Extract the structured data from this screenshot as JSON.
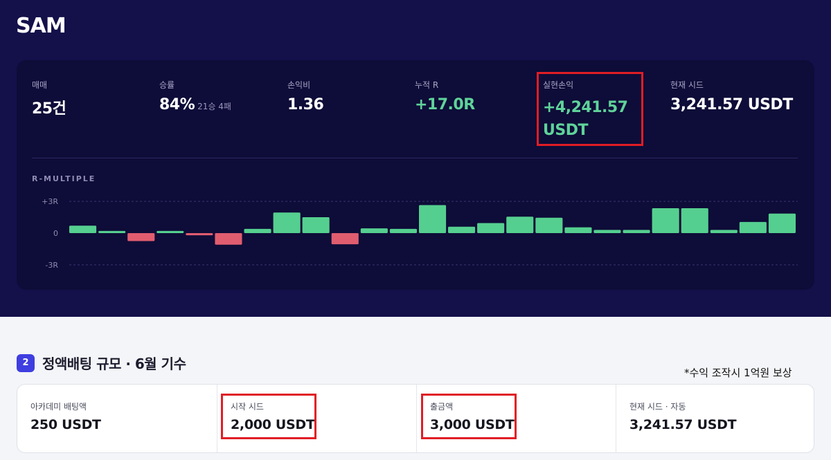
{
  "header": {
    "brand": "SAM"
  },
  "stats": {
    "trades": {
      "label": "매매",
      "value": "25건"
    },
    "win_rate": {
      "label": "승률",
      "value": "84%",
      "sub": "21승 4패"
    },
    "profit_loss_ratio": {
      "label": "손익비",
      "value": "1.36"
    },
    "cumulative_r": {
      "label": "누적 R",
      "value": "+17.0R"
    },
    "realized_pnl": {
      "label": "실현손익",
      "value_line1": "+4,241.57",
      "value_line2": "USDT"
    },
    "current_seed": {
      "label": "현재 시드",
      "value": "3,241.57 USDT"
    }
  },
  "chart_data": {
    "type": "bar",
    "title": "R-MULTIPLE",
    "yticks": [
      "+3R",
      "0",
      "-3R"
    ],
    "ylim": [
      -3,
      3
    ],
    "grid": true,
    "values": [
      0.7,
      0.2,
      -0.75,
      0.2,
      -0.2,
      -1.1,
      0.4,
      1.95,
      1.5,
      -1.05,
      0.45,
      0.4,
      2.65,
      0.6,
      0.95,
      1.55,
      1.45,
      0.55,
      0.3,
      0.3,
      2.35,
      2.35,
      0.3,
      1.05,
      1.85
    ],
    "colors": {
      "positive": "#55cf8f",
      "negative": "#e05d6f"
    }
  },
  "section": {
    "number": "2",
    "title": "정액배팅 규모 · 6월 기수",
    "note": "*수익 조작시 1억원 보상"
  },
  "seed_info": [
    {
      "label": "아카데미 배팅액",
      "value": "250 USDT"
    },
    {
      "label": "시작 시드",
      "value": "2,000 USDT"
    },
    {
      "label": "출금액",
      "value": "3,000 USDT"
    },
    {
      "label": "현재 시드 · 자동",
      "value": "3,241.57 USDT"
    }
  ]
}
